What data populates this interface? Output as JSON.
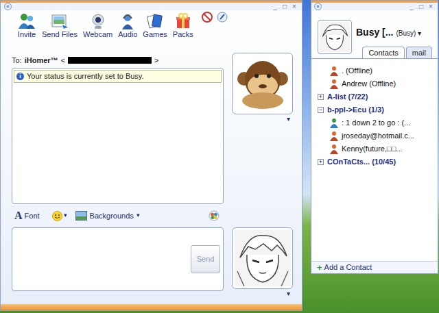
{
  "chat_window": {
    "controls": [
      "_",
      "□",
      "×"
    ],
    "toolbar": [
      {
        "label": "Invite"
      },
      {
        "label": "Send Files"
      },
      {
        "label": "Webcam"
      },
      {
        "label": "Audio"
      },
      {
        "label": "Games"
      },
      {
        "label": "Packs"
      }
    ],
    "to": {
      "label": "To:",
      "name": "iHomer™",
      "open": "<",
      "close": ">",
      "address_redacted": true
    },
    "history": {
      "info_icon": "i",
      "message": "Your status is currently set to Busy."
    },
    "contact_picture_arrow": "▾",
    "format_bar": {
      "font_icon": "A",
      "font": "Font",
      "emoticon_arrow": "▾",
      "backgrounds": "Backgrounds",
      "backgrounds_arrow": "▾"
    },
    "send": {
      "label": "Send",
      "disabled": true
    },
    "my_picture_arrow": "▾"
  },
  "contacts_window": {
    "controls": [
      "_",
      "□",
      "×"
    ],
    "display_name": "Busy [...",
    "status": "(Busy)",
    "status_arrow": "▾",
    "tabs": [
      {
        "label": "Contacts",
        "selected": true
      },
      {
        "label": "mail",
        "selected": false
      }
    ],
    "list": [
      {
        "kind": "contact",
        "name": ". (Offline)",
        "online": false
      },
      {
        "kind": "contact",
        "name": "Andrew (Offline)",
        "online": false
      },
      {
        "kind": "group",
        "name": "A-list (7/22)",
        "expanded": false,
        "toggle": "+"
      },
      {
        "kind": "group",
        "name": "b-ppl->Ecu (1/3)",
        "expanded": true,
        "toggle": "−"
      },
      {
        "kind": "contact",
        "name": ": 1 down 2 to go : (...",
        "online": true
      },
      {
        "kind": "contact",
        "name": "jroseday@hotmail.c...",
        "online": false
      },
      {
        "kind": "contact",
        "name": "Kenny(future,□□...",
        "online": false
      },
      {
        "kind": "group",
        "name": "COnTaCts... (10/45)",
        "expanded": false,
        "toggle": "+"
      }
    ],
    "add_icon": "+",
    "add_contact": "Add a Contact"
  }
}
